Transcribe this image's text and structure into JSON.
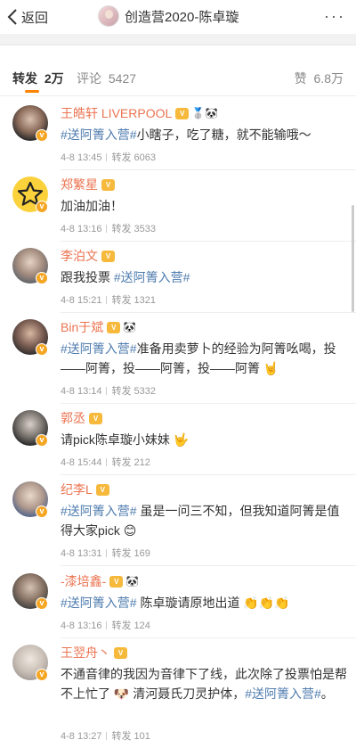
{
  "nav": {
    "back_label": "返回",
    "title": "创造营2020-陈卓璇",
    "more_label": "···"
  },
  "tabs": [
    {
      "label": "转发",
      "count": "2万"
    },
    {
      "label": "评论",
      "count": "5427"
    },
    {
      "label": "赞",
      "count": "6.8万"
    }
  ],
  "reposts": [
    {
      "name": "王皓轩 LIVERPOOL",
      "extra_icons": "🥈🐼",
      "segments": [
        {
          "t": "#送阿箐入营#",
          "tag": true
        },
        {
          "t": "小瞎子，吃了糖，就不能输哦～",
          "tag": false
        }
      ],
      "time": "4-8 13:45",
      "repost_count": "转发 6063"
    },
    {
      "name": "郑繁星",
      "extra_icons": "",
      "segments": [
        {
          "t": "加油加油！",
          "tag": false
        }
      ],
      "time": "4-8 13:16",
      "repost_count": "转发 3533"
    },
    {
      "name": "李泊文",
      "extra_icons": "",
      "segments": [
        {
          "t": "跟我投票  ",
          "tag": false
        },
        {
          "t": "#送阿箐入营#",
          "tag": true
        }
      ],
      "time": "4-8 15:21",
      "repost_count": "转发 1321"
    },
    {
      "name": "Bin于斌",
      "extra_icons": "🐼",
      "segments": [
        {
          "t": "#送阿箐入营#",
          "tag": true
        },
        {
          "t": "准备用卖萝卜的经验为阿箐吆喝，投——阿箐，投——阿箐，投——阿箐 🤘",
          "tag": false
        }
      ],
      "time": "4-8 13:14",
      "repost_count": "转发 5332"
    },
    {
      "name": "郭丞",
      "extra_icons": "",
      "segments": [
        {
          "t": "请pick陈卓璇小妹妹 🤟",
          "tag": false
        }
      ],
      "time": "4-8 15:44",
      "repost_count": "转发 212"
    },
    {
      "name": "纪李L",
      "extra_icons": "",
      "segments": [
        {
          "t": "#送阿箐入营#",
          "tag": true
        },
        {
          "t": " 虽是一问三不知，但我知道阿箐是值得大家pick 😊",
          "tag": false
        }
      ],
      "time": "4-8 13:31",
      "repost_count": "转发 169"
    },
    {
      "name": "-漆培鑫-",
      "extra_icons": "🐼",
      "segments": [
        {
          "t": "#送阿箐入营#",
          "tag": true
        },
        {
          "t": " 陈卓璇请原地出道 👏👏👏",
          "tag": false
        }
      ],
      "time": "4-8 13:16",
      "repost_count": "转发 124"
    },
    {
      "name": "王翌舟丶",
      "extra_icons": "",
      "segments": [
        {
          "t": "不通音律的我因为音律下了线，此次除了投票怕是帮不上忙了 🐶 清河聂氏刀灵护体，",
          "tag": false
        },
        {
          "t": "#送阿箐入营#",
          "tag": true
        },
        {
          "t": "。",
          "tag": false
        }
      ],
      "time": "4-8 13:27",
      "repost_count": "转发 101"
    }
  ],
  "colors": {
    "accent": "#ff8200",
    "username": "#eb7350",
    "topic": "#507daf",
    "verified": "#f5a623"
  }
}
